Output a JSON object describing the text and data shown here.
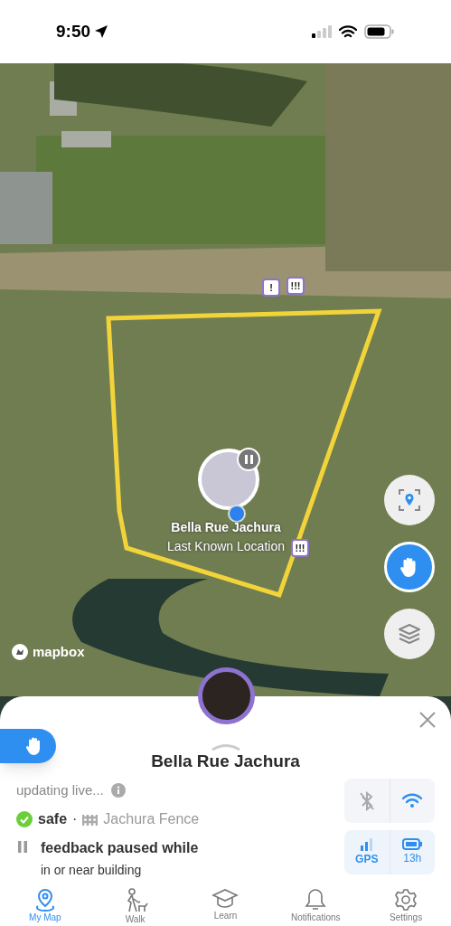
{
  "status_bar": {
    "time": "9:50"
  },
  "map": {
    "pet_name": "Bella Rue Jachura",
    "pet_status": "Last Known Location",
    "paused": true,
    "attribution": "mapbox",
    "alerts": [
      {
        "label": "!"
      },
      {
        "label": "!!!"
      },
      {
        "label": "!!!"
      }
    ],
    "buttons": [
      {
        "kind": "recenter",
        "active": false
      },
      {
        "kind": "hand",
        "active": true
      },
      {
        "kind": "layers",
        "active": false
      }
    ]
  },
  "sheet": {
    "title": "Bella Rue Jachura",
    "update": "updating live...",
    "safety": "safe",
    "separator": "·",
    "fence": "Jachura Fence",
    "feedback": "feedback paused while",
    "feedback_detail": "in or near building",
    "bluetooth_on": false,
    "wifi_on": true,
    "gps": "GPS",
    "battery": "13h"
  },
  "tabs": [
    {
      "label": "My Map",
      "selected": true
    },
    {
      "label": "Walk",
      "selected": false
    },
    {
      "label": "Learn",
      "selected": false
    },
    {
      "label": "Notifications",
      "selected": false
    },
    {
      "label": "Settings",
      "selected": false
    }
  ]
}
